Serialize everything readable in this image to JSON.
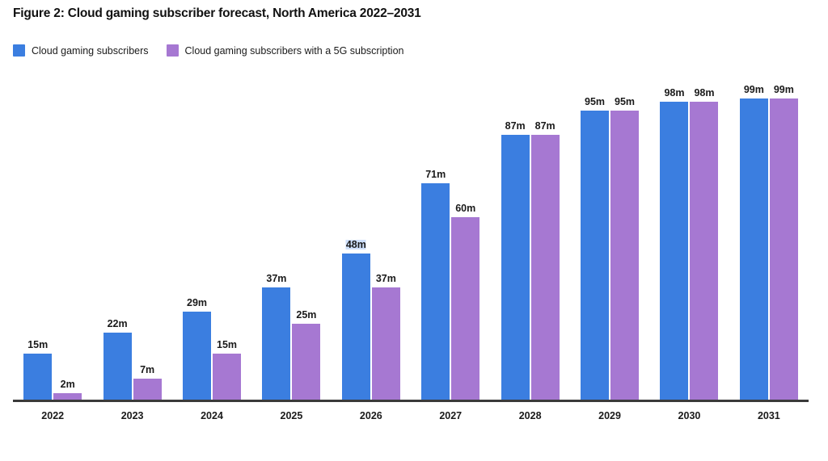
{
  "title": "Figure 2: Cloud gaming subscriber forecast, North America 2022–2031",
  "legend": {
    "items": [
      {
        "label": "Cloud gaming subscribers",
        "color": "#3b7ee0"
      },
      {
        "label": "Cloud gaming subscribers with a 5G subscription",
        "color": "#a678d2"
      }
    ]
  },
  "colors": {
    "series_blue": "#3b7ee0",
    "series_purple": "#a678d2",
    "axis": "#3a3a3a",
    "text": "#1a1a1a",
    "selection_highlight": "#cfe0fb"
  },
  "chart_data": {
    "type": "bar",
    "title": "Figure 2: Cloud gaming subscriber forecast, North America 2022–2031",
    "xlabel": "",
    "ylabel": "",
    "ylim": [
      0,
      99
    ],
    "grid": false,
    "legend_position": "top-left",
    "unit_suffix": "m",
    "categories": [
      "2022",
      "2023",
      "2024",
      "2025",
      "2026",
      "2027",
      "2028",
      "2029",
      "2030",
      "2031"
    ],
    "series": [
      {
        "name": "Cloud gaming subscribers",
        "color": "#3b7ee0",
        "values": [
          15,
          22,
          29,
          37,
          48,
          71,
          87,
          95,
          98,
          99
        ],
        "labels": [
          "15m",
          "22m",
          "29m",
          "37m",
          "48m",
          "71m",
          "87m",
          "95m",
          "98m",
          "99m"
        ]
      },
      {
        "name": "Cloud gaming subscribers with a 5G subscription",
        "color": "#a678d2",
        "values": [
          2,
          7,
          15,
          25,
          37,
          60,
          87,
          95,
          98,
          99
        ],
        "labels": [
          "2m",
          "7m",
          "15m",
          "25m",
          "37m",
          "60m",
          "87m",
          "95m",
          "98m",
          "99m"
        ]
      }
    ],
    "annotations": [
      {
        "text": "48m",
        "note": "value label rendered with a text-selection highlight"
      }
    ]
  },
  "x_axis": {
    "ticks": [
      "2022",
      "2023",
      "2024",
      "2025",
      "2026",
      "2027",
      "2028",
      "2029",
      "2030",
      "2031"
    ]
  }
}
